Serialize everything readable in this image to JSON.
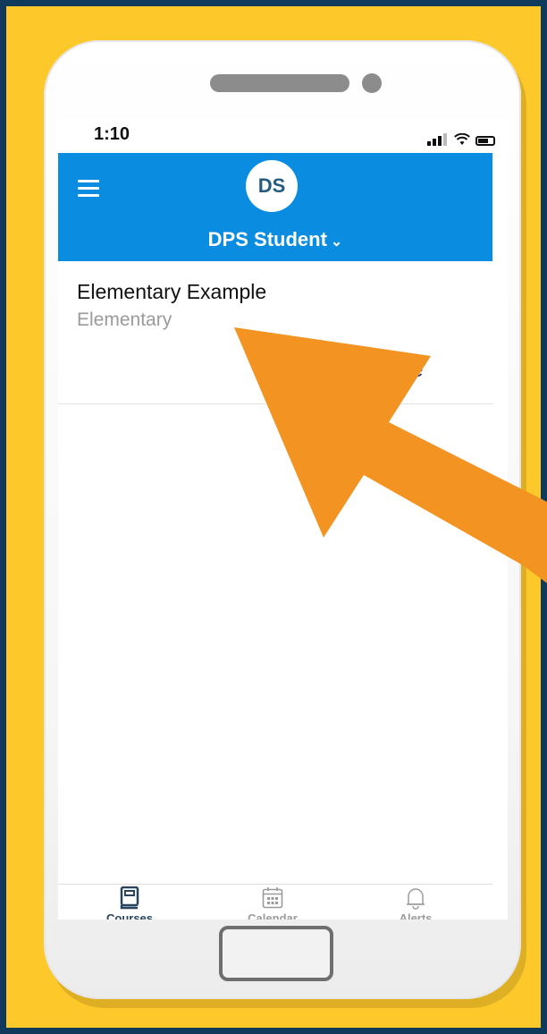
{
  "status_bar": {
    "time": "1:10"
  },
  "header": {
    "avatar_initials": "DS",
    "account_name": "DPS Student",
    "chevron": "⌄"
  },
  "course": {
    "title": "Elementary Example",
    "subtitle": "Elementary",
    "grade_link": "ade"
  },
  "tabs": [
    {
      "label": "Courses",
      "icon": "book-icon",
      "active": true
    },
    {
      "label": "Calendar",
      "icon": "calendar-icon",
      "active": false
    },
    {
      "label": "Alerts",
      "icon": "bell-icon",
      "active": false
    }
  ],
  "colors": {
    "background": "#0f3a5c",
    "frame": "#fdc82a",
    "header": "#0a8de0",
    "arrow": "#f39322",
    "tab_active": "#27445e",
    "tab_inactive": "#9b9b9b"
  }
}
